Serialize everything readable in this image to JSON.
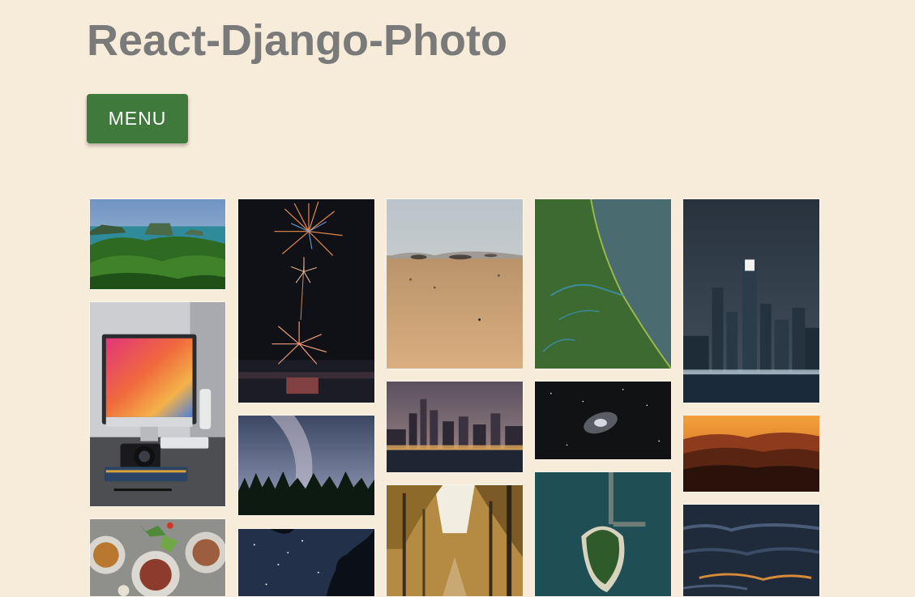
{
  "header": {
    "title": "React-Django-Photo"
  },
  "menu_button": {
    "label": "MENU",
    "color": "#3f7a3c"
  },
  "gallery": {
    "photos": [
      {
        "subject": "tropical-islands"
      },
      {
        "subject": "imac-desk-camera"
      },
      {
        "subject": "food-plates"
      },
      {
        "subject": "fireworks"
      },
      {
        "subject": "milky-way-forest"
      },
      {
        "subject": "starry-sky-trees"
      },
      {
        "subject": "desert"
      },
      {
        "subject": "city-skyline-night"
      },
      {
        "subject": "autumn-forest"
      },
      {
        "subject": "aerial-coastline"
      },
      {
        "subject": "galaxy"
      },
      {
        "subject": "island-aerial"
      },
      {
        "subject": "skyscraper-city-night"
      },
      {
        "subject": "sunset-mountains"
      },
      {
        "subject": "ocean-waves"
      }
    ]
  }
}
